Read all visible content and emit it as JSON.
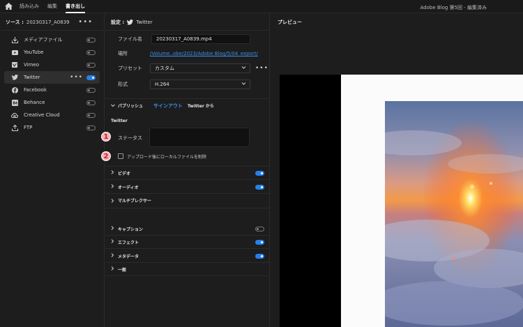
{
  "topbar": {
    "tabs": [
      "読み込み",
      "編集",
      "書き出し"
    ],
    "active_tab": "書き出し",
    "document_title": "Adobe Blog 第5回 - 編集済み"
  },
  "source": {
    "label": "ソース :",
    "value": "20230317_A0839",
    "more": "•••"
  },
  "destinations": [
    {
      "label": "メディアファイル",
      "icon": "download-icon",
      "on": false
    },
    {
      "label": "YouTube",
      "icon": "youtube-icon",
      "on": false
    },
    {
      "label": "Vimeo",
      "icon": "vimeo-icon",
      "on": false
    },
    {
      "label": "Twitter",
      "icon": "twitter-icon",
      "on": true,
      "selected": true
    },
    {
      "label": "Facebook",
      "icon": "facebook-icon",
      "on": false
    },
    {
      "label": "Behance",
      "icon": "behance-icon",
      "on": false
    },
    {
      "label": "Creative Cloud",
      "icon": "creative-cloud-icon",
      "on": false
    },
    {
      "label": "FTP",
      "icon": "upload-icon",
      "on": false
    }
  ],
  "settings": {
    "label": "設定 :",
    "target": "Twitter",
    "file_name_label": "ファイル名",
    "file_name": "20230317_A0839.mp4",
    "location_label": "場所",
    "location": "/Volume..obe/2023/Adobe Blog/5/04_export/",
    "preset_label": "プリセット",
    "preset": "カスタム",
    "format_label": "形式",
    "format": "H.264",
    "more": "•••"
  },
  "publish": {
    "title": "パブリッシュ",
    "sign_out": "サインアウト",
    "from": "Twitter から",
    "service": "Twitter",
    "status_label": "ステータス",
    "status_value": "",
    "delete_label": "アップロード後にローカルファイルを削除",
    "delete_checked": false,
    "badge1": "1",
    "badge2": "2"
  },
  "sections": [
    {
      "title": "ビデオ",
      "on": true
    },
    {
      "title": "オーディオ",
      "on": true
    },
    {
      "title": "マルチプレクサー",
      "on": null
    },
    {
      "title": "キャプション",
      "on": false
    },
    {
      "title": "エフェクト",
      "on": true
    },
    {
      "title": "メタデータ",
      "on": true
    },
    {
      "title": "一般",
      "on": null
    }
  ],
  "preview": {
    "title": "プレビュー"
  },
  "colors": {
    "accent": "#2680eb",
    "link": "#3b8fe8",
    "badge_bg": "#f3b2b5",
    "badge_fg": "#c81f2b"
  }
}
